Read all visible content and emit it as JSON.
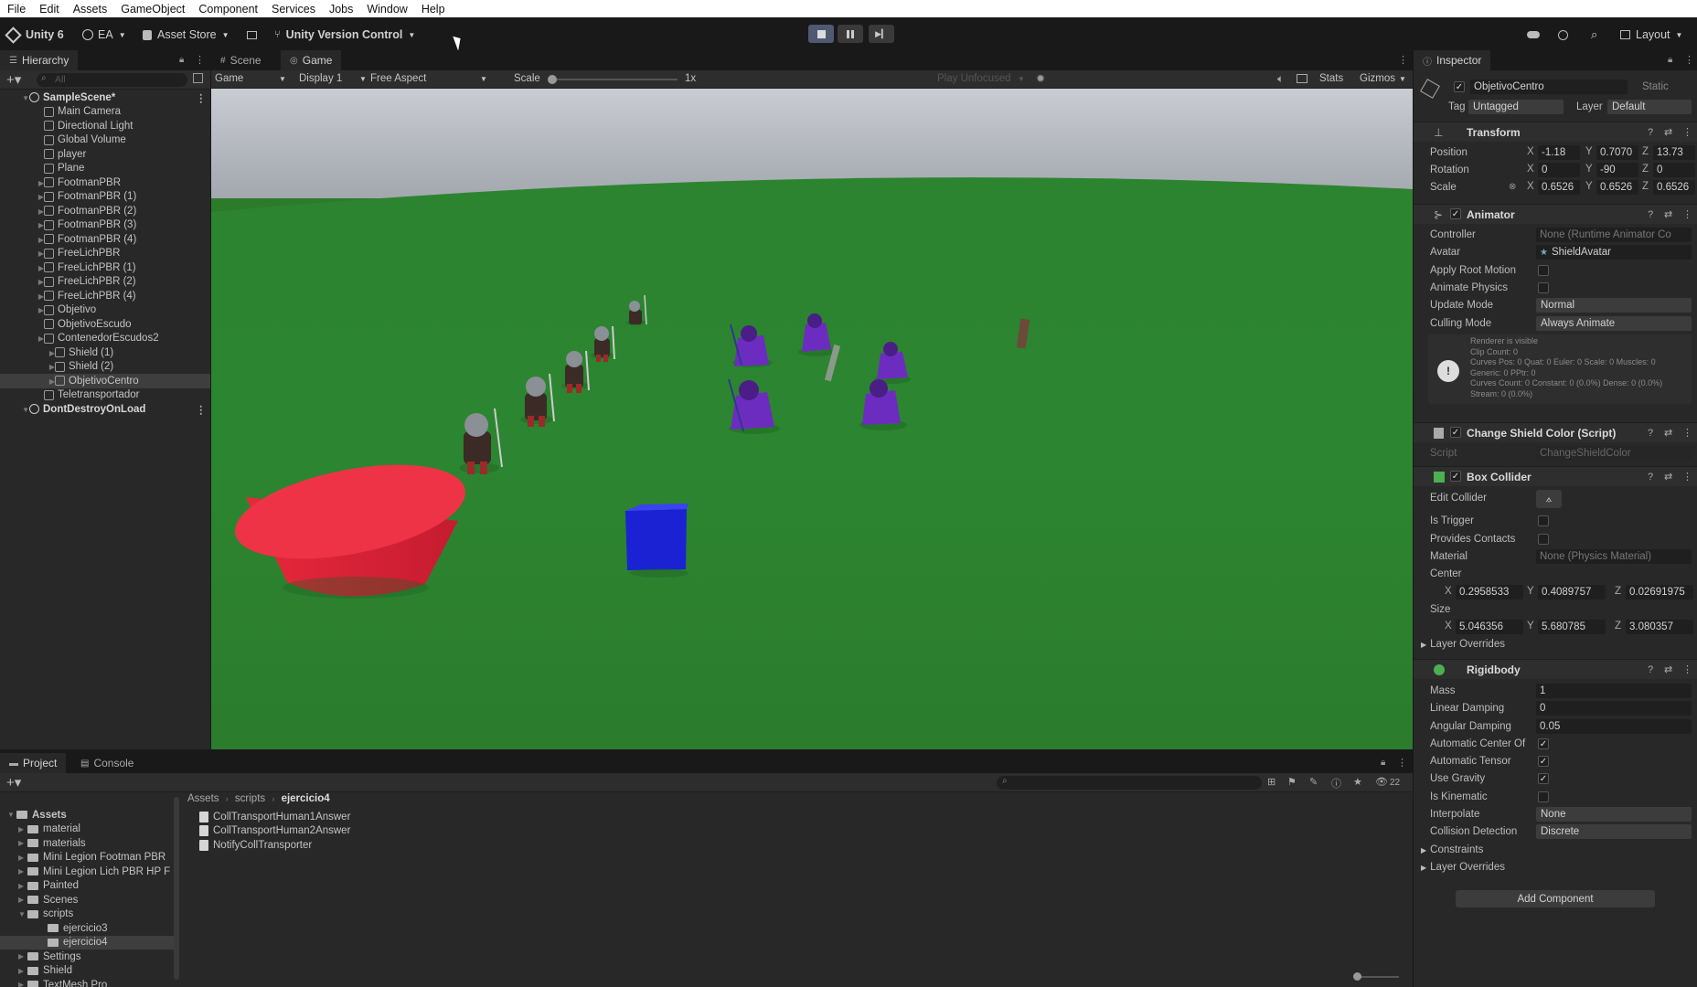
{
  "menu": [
    "File",
    "Edit",
    "Assets",
    "GameObject",
    "Component",
    "Services",
    "Jobs",
    "Window",
    "Help"
  ],
  "toolbar": {
    "unity": "Unity 6",
    "account": "EA",
    "asset_store": "Asset Store",
    "version_control": "Unity Version Control",
    "layout": "Layout"
  },
  "hierarchy": {
    "tab": "Hierarchy",
    "search_placeholder": "All",
    "items": [
      {
        "label": "SampleScene*",
        "depth": 0,
        "kind": "scene"
      },
      {
        "label": "Main Camera",
        "depth": 1
      },
      {
        "label": "Directional Light",
        "depth": 1
      },
      {
        "label": "Global Volume",
        "depth": 1
      },
      {
        "label": "player",
        "depth": 1
      },
      {
        "label": "Plane",
        "depth": 1
      },
      {
        "label": "FootmanPBR",
        "depth": 1,
        "expand": true
      },
      {
        "label": "FootmanPBR (1)",
        "depth": 1,
        "expand": true
      },
      {
        "label": "FootmanPBR (2)",
        "depth": 1,
        "expand": true
      },
      {
        "label": "FootmanPBR (3)",
        "depth": 1,
        "expand": true
      },
      {
        "label": "FootmanPBR (4)",
        "depth": 1,
        "expand": true
      },
      {
        "label": "FreeLichPBR",
        "depth": 1,
        "expand": true
      },
      {
        "label": "FreeLichPBR (1)",
        "depth": 1,
        "expand": true
      },
      {
        "label": "FreeLichPBR (2)",
        "depth": 1,
        "expand": true
      },
      {
        "label": "FreeLichPBR (4)",
        "depth": 1,
        "expand": true
      },
      {
        "label": "Objetivo",
        "depth": 1,
        "expand": true
      },
      {
        "label": "ObjetivoEscudo",
        "depth": 1
      },
      {
        "label": "ContenedorEscudos2",
        "depth": 1,
        "expand": true
      },
      {
        "label": "Shield (1)",
        "depth": 2,
        "expand": true
      },
      {
        "label": "Shield (2)",
        "depth": 2,
        "expand": true
      },
      {
        "label": "ObjetivoCentro",
        "depth": 2,
        "expand": true,
        "selected": true
      },
      {
        "label": "Teletransportador",
        "depth": 1
      },
      {
        "label": "DontDestroyOnLoad",
        "depth": 0,
        "kind": "scene"
      }
    ]
  },
  "game": {
    "tabs": [
      "Scene",
      "Game"
    ],
    "mode": "Game",
    "display": "Display 1",
    "aspect": "Free Aspect",
    "scale_label": "Scale",
    "scale_value": "1x",
    "play_focused": "Play Unfocused",
    "stats": "Stats",
    "gizmos": "Gizmos"
  },
  "inspector": {
    "tab": "Inspector",
    "object_name": "ObjetivoCentro",
    "static_label": "Static",
    "tag_label": "Tag",
    "tag_value": "Untagged",
    "layer_label": "Layer",
    "layer_value": "Default",
    "transform": {
      "title": "Transform",
      "position_label": "Position",
      "rotation_label": "Rotation",
      "scale_label": "Scale",
      "position": [
        "-1.18",
        "0.7070",
        "13.73"
      ],
      "rotation": [
        "0",
        "-90",
        "0"
      ],
      "scale": [
        "0.6526",
        "0.6526",
        "0.6526"
      ]
    },
    "animator": {
      "title": "Animator",
      "controller_label": "Controller",
      "controller_value": "None (Runtime Animator Co",
      "avatar_label": "Avatar",
      "avatar_value": "ShieldAvatar",
      "root_motion_label": "Apply Root Motion",
      "animate_physics_label": "Animate Physics",
      "update_mode_label": "Update Mode",
      "update_mode_value": "Normal",
      "culling_mode_label": "Culling Mode",
      "culling_mode_value": "Always Animate",
      "info_lines": [
        "Renderer is visible",
        "Clip Count: 0",
        "Curves Pos: 0 Quat: 0 Euler: 0 Scale: 0 Muscles: 0",
        "Generic: 0 PPtr: 0",
        "Curves Count: 0 Constant: 0 (0.0%) Dense: 0 (0.0%)",
        "Stream: 0 (0.0%)"
      ]
    },
    "change_shield": {
      "title": "Change Shield Color (Script)",
      "script_label": "Script",
      "script_value": "ChangeShieldColor"
    },
    "box_collider": {
      "title": "Box Collider",
      "edit_label": "Edit Collider",
      "is_trigger_label": "Is Trigger",
      "provides_contacts_label": "Provides Contacts",
      "material_label": "Material",
      "material_value": "None (Physics Material)",
      "center_label": "Center",
      "center": [
        "0.2958533",
        "0.4089757",
        "0.02691975"
      ],
      "size_label": "Size",
      "size": [
        "5.046356",
        "5.680785",
        "3.080357"
      ],
      "layer_overrides": "Layer Overrides"
    },
    "rigidbody": {
      "title": "Rigidbody",
      "mass_label": "Mass",
      "mass": "1",
      "linear_damping_label": "Linear Damping",
      "linear_damping": "0",
      "angular_damping_label": "Angular Damping",
      "angular_damping": "0.05",
      "auto_center_label": "Automatic Center Of",
      "auto_tensor_label": "Automatic Tensor",
      "use_gravity_label": "Use Gravity",
      "is_kinematic_label": "Is Kinematic",
      "interpolate_label": "Interpolate",
      "interpolate_value": "None",
      "collision_label": "Collision Detection",
      "collision_value": "Discrete",
      "constraints": "Constraints",
      "layer_overrides": "Layer Overrides"
    },
    "add_component": "Add Component"
  },
  "project": {
    "tabs": [
      "Project",
      "Console"
    ],
    "tree": [
      {
        "label": "Assets",
        "depth": 0,
        "bold": true
      },
      {
        "label": "material",
        "depth": 1
      },
      {
        "label": "materials",
        "depth": 1
      },
      {
        "label": "Mini Legion Footman PBR",
        "depth": 1
      },
      {
        "label": "Mini Legion Lich PBR HP F",
        "depth": 1
      },
      {
        "label": "Painted",
        "depth": 1
      },
      {
        "label": "Scenes",
        "depth": 1
      },
      {
        "label": "scripts",
        "depth": 1
      },
      {
        "label": "ejercicio3",
        "depth": 2
      },
      {
        "label": "ejercicio4",
        "depth": 2,
        "selected": true
      },
      {
        "label": "Settings",
        "depth": 1
      },
      {
        "label": "Shield",
        "depth": 1
      },
      {
        "label": "TextMesh Pro",
        "depth": 1
      }
    ],
    "breadcrumb": [
      "Assets",
      "scripts",
      "ejercicio4"
    ],
    "files": [
      "CollTransportHuman1Answer",
      "CollTransportHuman2Answer",
      "NotifyCollTransporter"
    ],
    "count": "22"
  },
  "colors": {
    "ground": "#2f8a35",
    "sky": "#b9bdc4",
    "red_cylinder": "#e8283c",
    "blue_cube": "#1a22d4",
    "lich_purple": "#6d2cc0",
    "selection": "#3e3e3e"
  }
}
